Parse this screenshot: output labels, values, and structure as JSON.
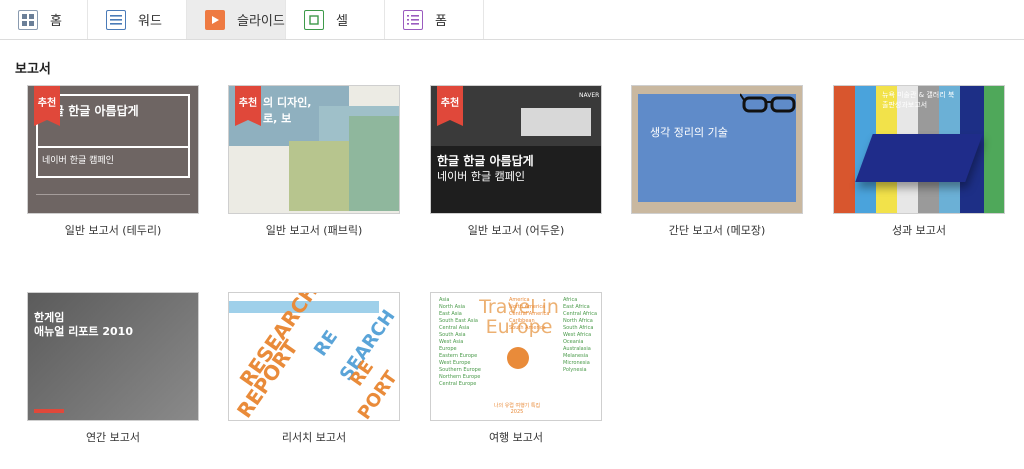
{
  "tabs": [
    {
      "label": "홈",
      "icon": "grid-icon"
    },
    {
      "label": "워드",
      "icon": "document-icon"
    },
    {
      "label": "슬라이드",
      "icon": "play-icon"
    },
    {
      "label": "셀",
      "icon": "square-icon"
    },
    {
      "label": "폼",
      "icon": "list-icon"
    }
  ],
  "section": {
    "title": "보고서"
  },
  "badge_label": "추천",
  "templates": [
    {
      "caption": "일반 보고서 (테두리)",
      "thumb_title": "한글 한글 아름답게",
      "thumb_sub": "네이버 한글 캠페인"
    },
    {
      "caption": "일반 보고서 (패브릭)",
      "thumb_title": "의 디자인,",
      "thumb_sub": "로, 보"
    },
    {
      "caption": "일반 보고서 (어두운)",
      "thumb_title": "한글 한글 아름답게",
      "thumb_sub": "네이버 한글 캠페인",
      "thumb_logo": "NAVER"
    },
    {
      "caption": "간단 보고서 (메모장)",
      "thumb_title": "생각 정리의 기술"
    },
    {
      "caption": "성과 보고서",
      "thumb_title": "뉴욕 미술관 & 갤러리 북 출판성과보고서"
    },
    {
      "caption": "연간 보고서",
      "thumb_title": "한게임",
      "thumb_sub": "애뉴얼 리포트 2010"
    },
    {
      "caption": "리서치 보고서",
      "thumb_words": [
        "RESEARCH",
        "REPORT",
        "RE",
        "SEARCH",
        "RE",
        "PORT"
      ]
    },
    {
      "caption": "여행 보고서",
      "thumb_title": "Travel in Europe",
      "thumb_left": [
        "Asia",
        "North Asia",
        "East Asia",
        "South East Asia",
        "Central Asia",
        "South Asia",
        "West Asia",
        "Europe",
        "Eastern Europe",
        "West Europe",
        "Southern Europe",
        "Northern Europe",
        "Central Europe"
      ],
      "thumb_mid": [
        "America",
        "North America",
        "Central America",
        "Caribbean",
        "South America"
      ],
      "thumb_right": [
        "Africa",
        "East Africa",
        "Central Africa",
        "North Africa",
        "South Africa",
        "West Africa",
        "Oceania",
        "Australasia",
        "Melanesia",
        "Micronesia",
        "Polynesia"
      ],
      "thumb_foot": "나의 유럽 여행기 특집 2025"
    }
  ]
}
